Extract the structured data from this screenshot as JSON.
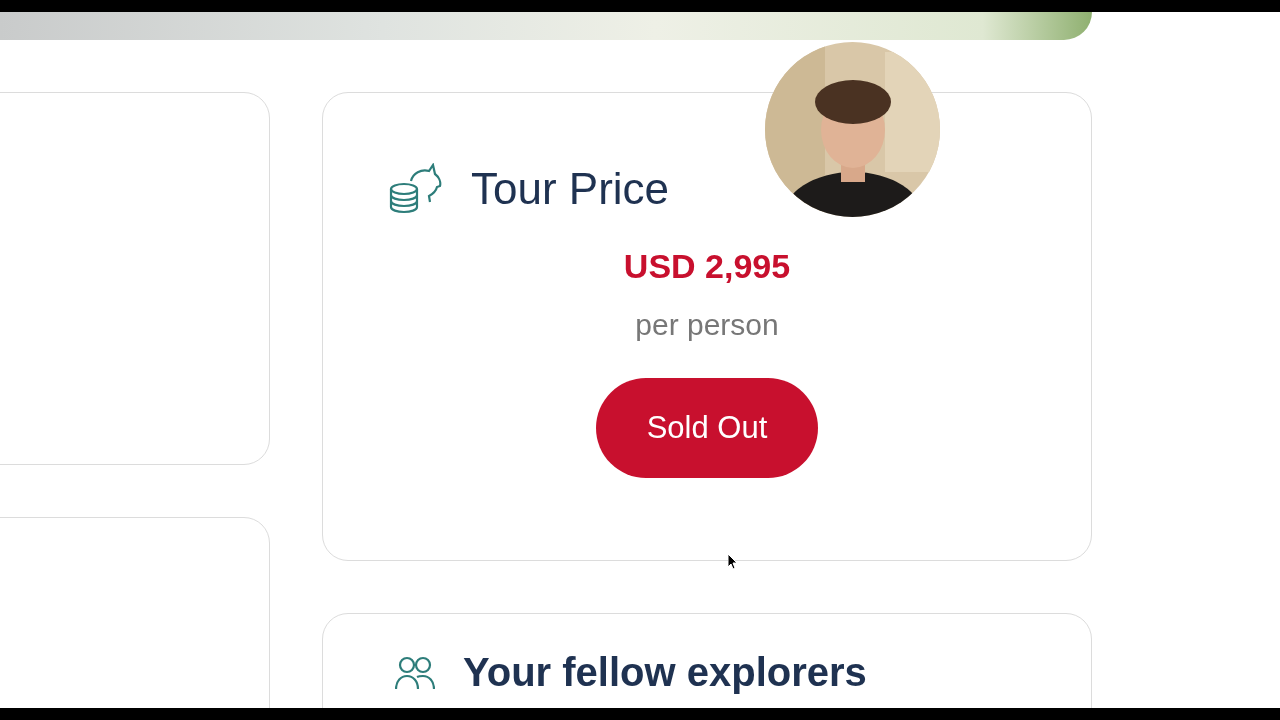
{
  "price_card": {
    "title": "Tour Price",
    "price": "USD 2,995",
    "unit": "per person",
    "button": "Sold Out"
  },
  "next_card": {
    "title": "Your fellow explorers"
  }
}
